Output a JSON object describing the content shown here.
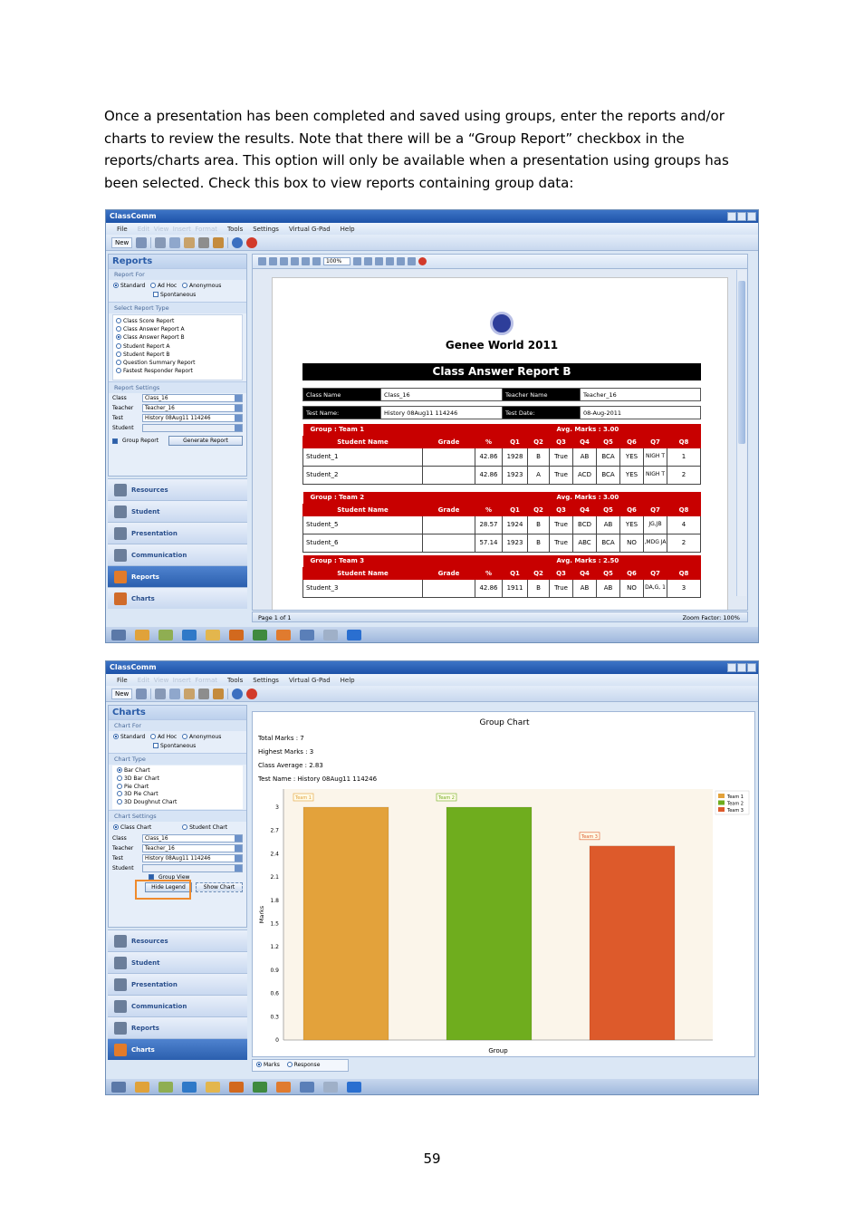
{
  "intro_text": "Once a presentation has been completed and saved using groups, enter the reports and/or charts to review the results.  Note that there will be a “Group Report” checkbox in the reports/charts area.  This option will only be available when a presentation using groups has been selected.  Check this box to view reports containing group data:",
  "page_number": "59",
  "app": {
    "title": "ClassComm",
    "menu": [
      "File",
      "Tools",
      "Settings",
      "Virtual G-Pad",
      "Help"
    ],
    "new_label": "New"
  },
  "reports_window": {
    "panel_title": "Reports",
    "report_for_label": "Report For",
    "report_for_options": [
      "Standard",
      "Ad Hoc",
      "Anonymous",
      "Spontaneous"
    ],
    "report_type_label": "Select Report Type",
    "report_types": [
      "Class Score Report",
      "Class Answer Report A",
      "Class Answer Report B",
      "Student Report A",
      "Student Report B",
      "Question Summary Report",
      "Fastest Responder Report"
    ],
    "selected_report_type": "Class Answer Report B",
    "settings_label": "Report Settings",
    "class_label": "Class",
    "class_value": "Class_16",
    "teacher_label": "Teacher",
    "teacher_value": "Teacher_16",
    "test_label": "Test",
    "test_value": "History 08Aug11 114246",
    "student_label": "Student",
    "group_report_label": "Group Report",
    "generate_label": "Generate Report",
    "zoom": "100%",
    "page_status": "Page 1 of 1",
    "zoom_status": "Zoom Factor: 100%",
    "report": {
      "org": "Genee World 2011",
      "title": "Class Answer Report B",
      "class_name_label": "Class Name",
      "class_name": "Class_16",
      "teacher_name_label": "Teacher Name",
      "teacher_name": "Teacher_16",
      "test_name_label": "Test Name:",
      "test_name": "History 08Aug11 114246",
      "test_date_label": "Test Date:",
      "test_date": "08-Aug-2011",
      "columns": [
        "Student Name",
        "Grade",
        "%",
        "Q1",
        "Q2",
        "Q3",
        "Q4",
        "Q5",
        "Q6",
        "Q7",
        "Q8"
      ],
      "groups": [
        {
          "label": "Group :  Team 1",
          "avg": "Avg. Marks :   3.00",
          "rows": [
            [
              "Student_1",
              "",
              "42.86",
              "1928",
              "B",
              "True",
              "AB",
              "BCA",
              "YES",
              "NIGH T",
              "1"
            ],
            [
              "Student_2",
              "",
              "42.86",
              "1923",
              "A",
              "True",
              "ACD",
              "BCA",
              "YES",
              "NIGH T",
              "2"
            ]
          ]
        },
        {
          "label": "Group :  Team 2",
          "avg": "Avg. Marks :   3.00",
          "rows": [
            [
              "Student_5",
              "",
              "28.57",
              "1924",
              "B",
              "True",
              "BCD",
              "AB",
              "YES",
              "JG,JB",
              "4"
            ],
            [
              "Student_6",
              "",
              "57.14",
              "1923",
              "B",
              "True",
              "ABC",
              "BCA",
              "NO",
              ",MDG JA",
              "2"
            ]
          ]
        },
        {
          "label": "Group :  Team 3",
          "avg": "Avg. Marks :   2.50",
          "rows": [
            [
              "Student_3",
              "",
              "42.86",
              "1911",
              "B",
              "True",
              "AB",
              "AB",
              "NO",
              "DA,G, 1",
              "3"
            ]
          ]
        }
      ]
    }
  },
  "charts_window": {
    "panel_title": "Charts",
    "chart_for_label": "Chart For",
    "chart_for_options": [
      "Standard",
      "Ad Hoc",
      "Anonymous",
      "Spontaneous"
    ],
    "chart_type_label": "Chart Type",
    "chart_types": [
      "Bar Chart",
      "3D Bar Chart",
      "Pie Chart",
      "3D Pie Chart",
      "3D Doughnut Chart"
    ],
    "settings_label": "Chart Settings",
    "class_chart_label": "Class Chart",
    "student_chart_label": "Student Chart",
    "class_label": "Class",
    "class_value": "Class_16",
    "teacher_label": "Teacher",
    "teacher_value": "Teacher_16",
    "test_label": "Test",
    "test_value": "History 08Aug11 114246",
    "student_label": "Student",
    "group_view_label": "Group View",
    "hide_legend_label": "Hide Legend",
    "show_chart_label": "Show Chart",
    "stats": [
      "Total Marks : 7",
      "Highest Marks : 3",
      "Class Average : 2.83",
      "Test Name : History 08Aug11 114246"
    ],
    "foot_options": [
      "Marks",
      "Response"
    ]
  },
  "nav_items": [
    "Resources",
    "Student",
    "Presentation",
    "Communication",
    "Reports",
    "Charts"
  ],
  "chart_data": {
    "type": "bar",
    "title": "Group Chart",
    "categories": [
      "Team 1",
      "Team 2",
      "Team 3"
    ],
    "values": [
      3,
      3,
      2.5
    ],
    "colors": [
      "#e3a23b",
      "#6fad1e",
      "#dd5a2b"
    ],
    "xlabel": "Group",
    "ylabel": "Marks",
    "ylim": [
      0,
      3
    ],
    "yticks": [
      "0",
      "0.3",
      "0.6",
      "0.9",
      "1.2",
      "1.5",
      "1.8",
      "2.1",
      "2.4",
      "2.7",
      "3"
    ],
    "legend": [
      "Team 1",
      "Team 2",
      "Team 3"
    ],
    "legend_position": "top-right",
    "grid": false
  }
}
